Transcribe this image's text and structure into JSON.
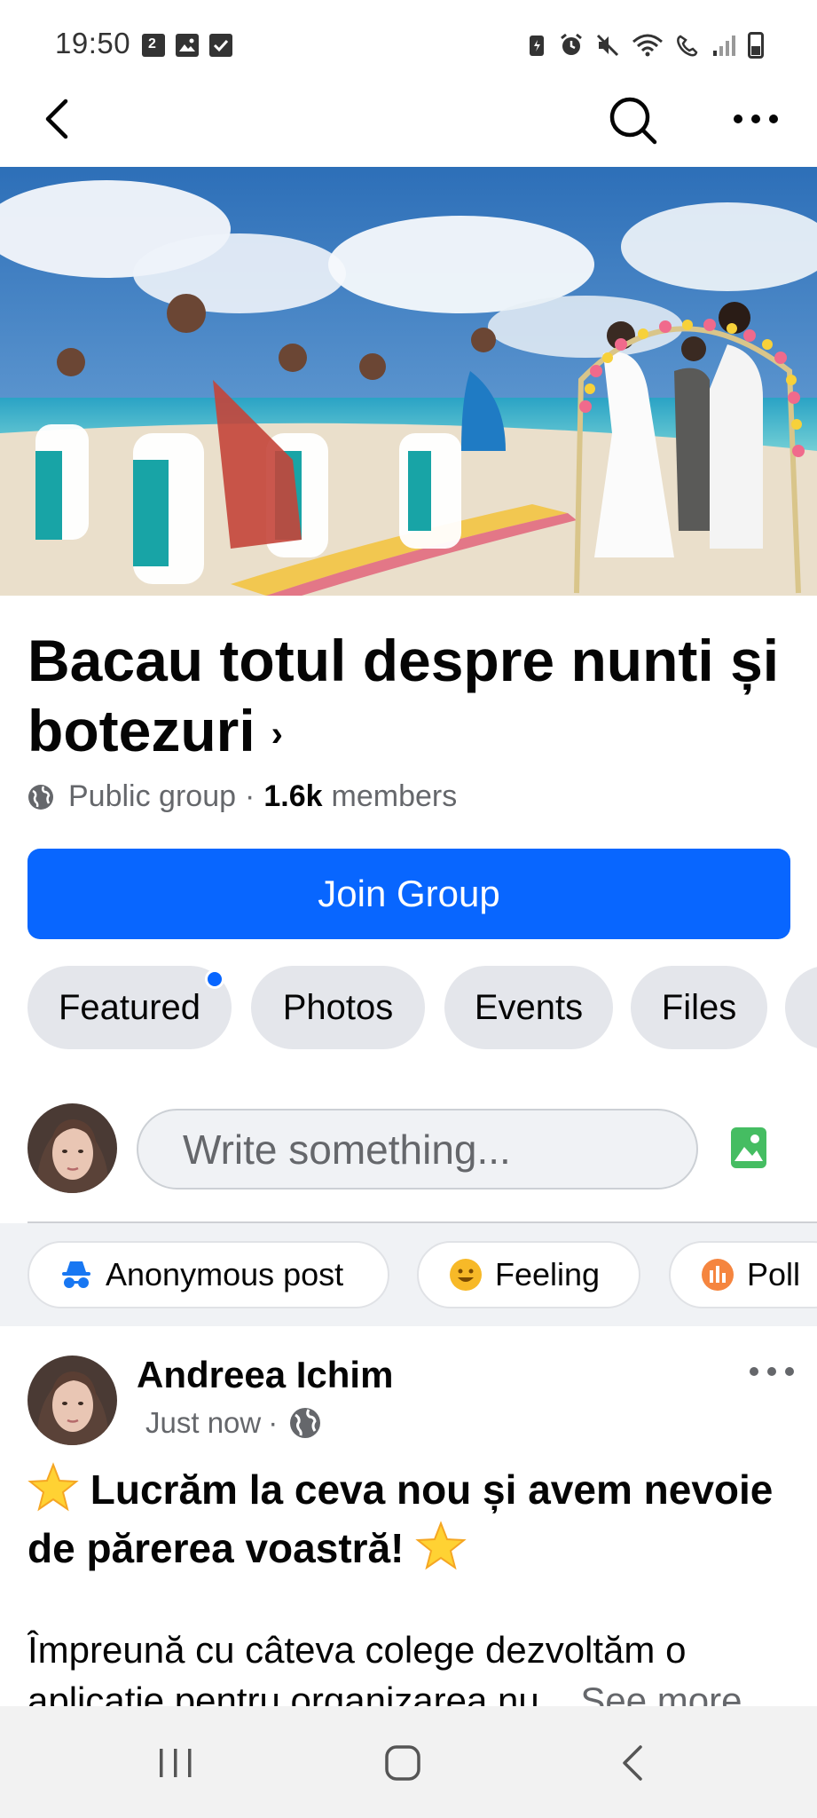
{
  "status_bar": {
    "time": "19:50",
    "left_icons": [
      "calendar-icon",
      "gallery-icon",
      "checkbox-icon"
    ],
    "right_icons": [
      "battery-saver-icon",
      "alarm-icon",
      "mute-icon",
      "wifi-icon",
      "wifi-calling-icon",
      "signal-icon",
      "battery-icon"
    ]
  },
  "header": {
    "back_icon": "chevron-left-icon",
    "search_icon": "search-icon",
    "more_icon": "more-horizontal-icon"
  },
  "group": {
    "title": "Bacau totul despre nunti și botezuri",
    "title_chevron": "›",
    "privacy": "Public group",
    "separator": "·",
    "members_count": "1.6k",
    "members_label": "members",
    "join_label": "Join Group"
  },
  "tabs": [
    {
      "label": "Featured",
      "has_dot": true
    },
    {
      "label": "Photos"
    },
    {
      "label": "Events"
    },
    {
      "label": "Files"
    }
  ],
  "composer": {
    "placeholder": "Write something..."
  },
  "post_options": [
    {
      "label": "Anonymous post",
      "icon": "anonymous-icon"
    },
    {
      "label": "Feeling",
      "icon": "feeling-icon"
    },
    {
      "label": "Poll",
      "icon": "poll-icon"
    }
  ],
  "post": {
    "author": "Andreea Ichim",
    "time": "Just now",
    "separator": "·",
    "headline": "Lucrăm la ceva nou și avem nevoie de părerea voastră!",
    "body": "Împreună cu câteva colege dezvoltăm o aplicație pentru organizarea nu...",
    "see_more": "See more"
  },
  "colors": {
    "accent": "#0866ff",
    "chip_bg": "#e4e6eb",
    "secondary_text": "#65676b",
    "photo_green": "#45bd62",
    "feeling_yellow": "#f7b928",
    "poll_orange": "#f5853f"
  }
}
